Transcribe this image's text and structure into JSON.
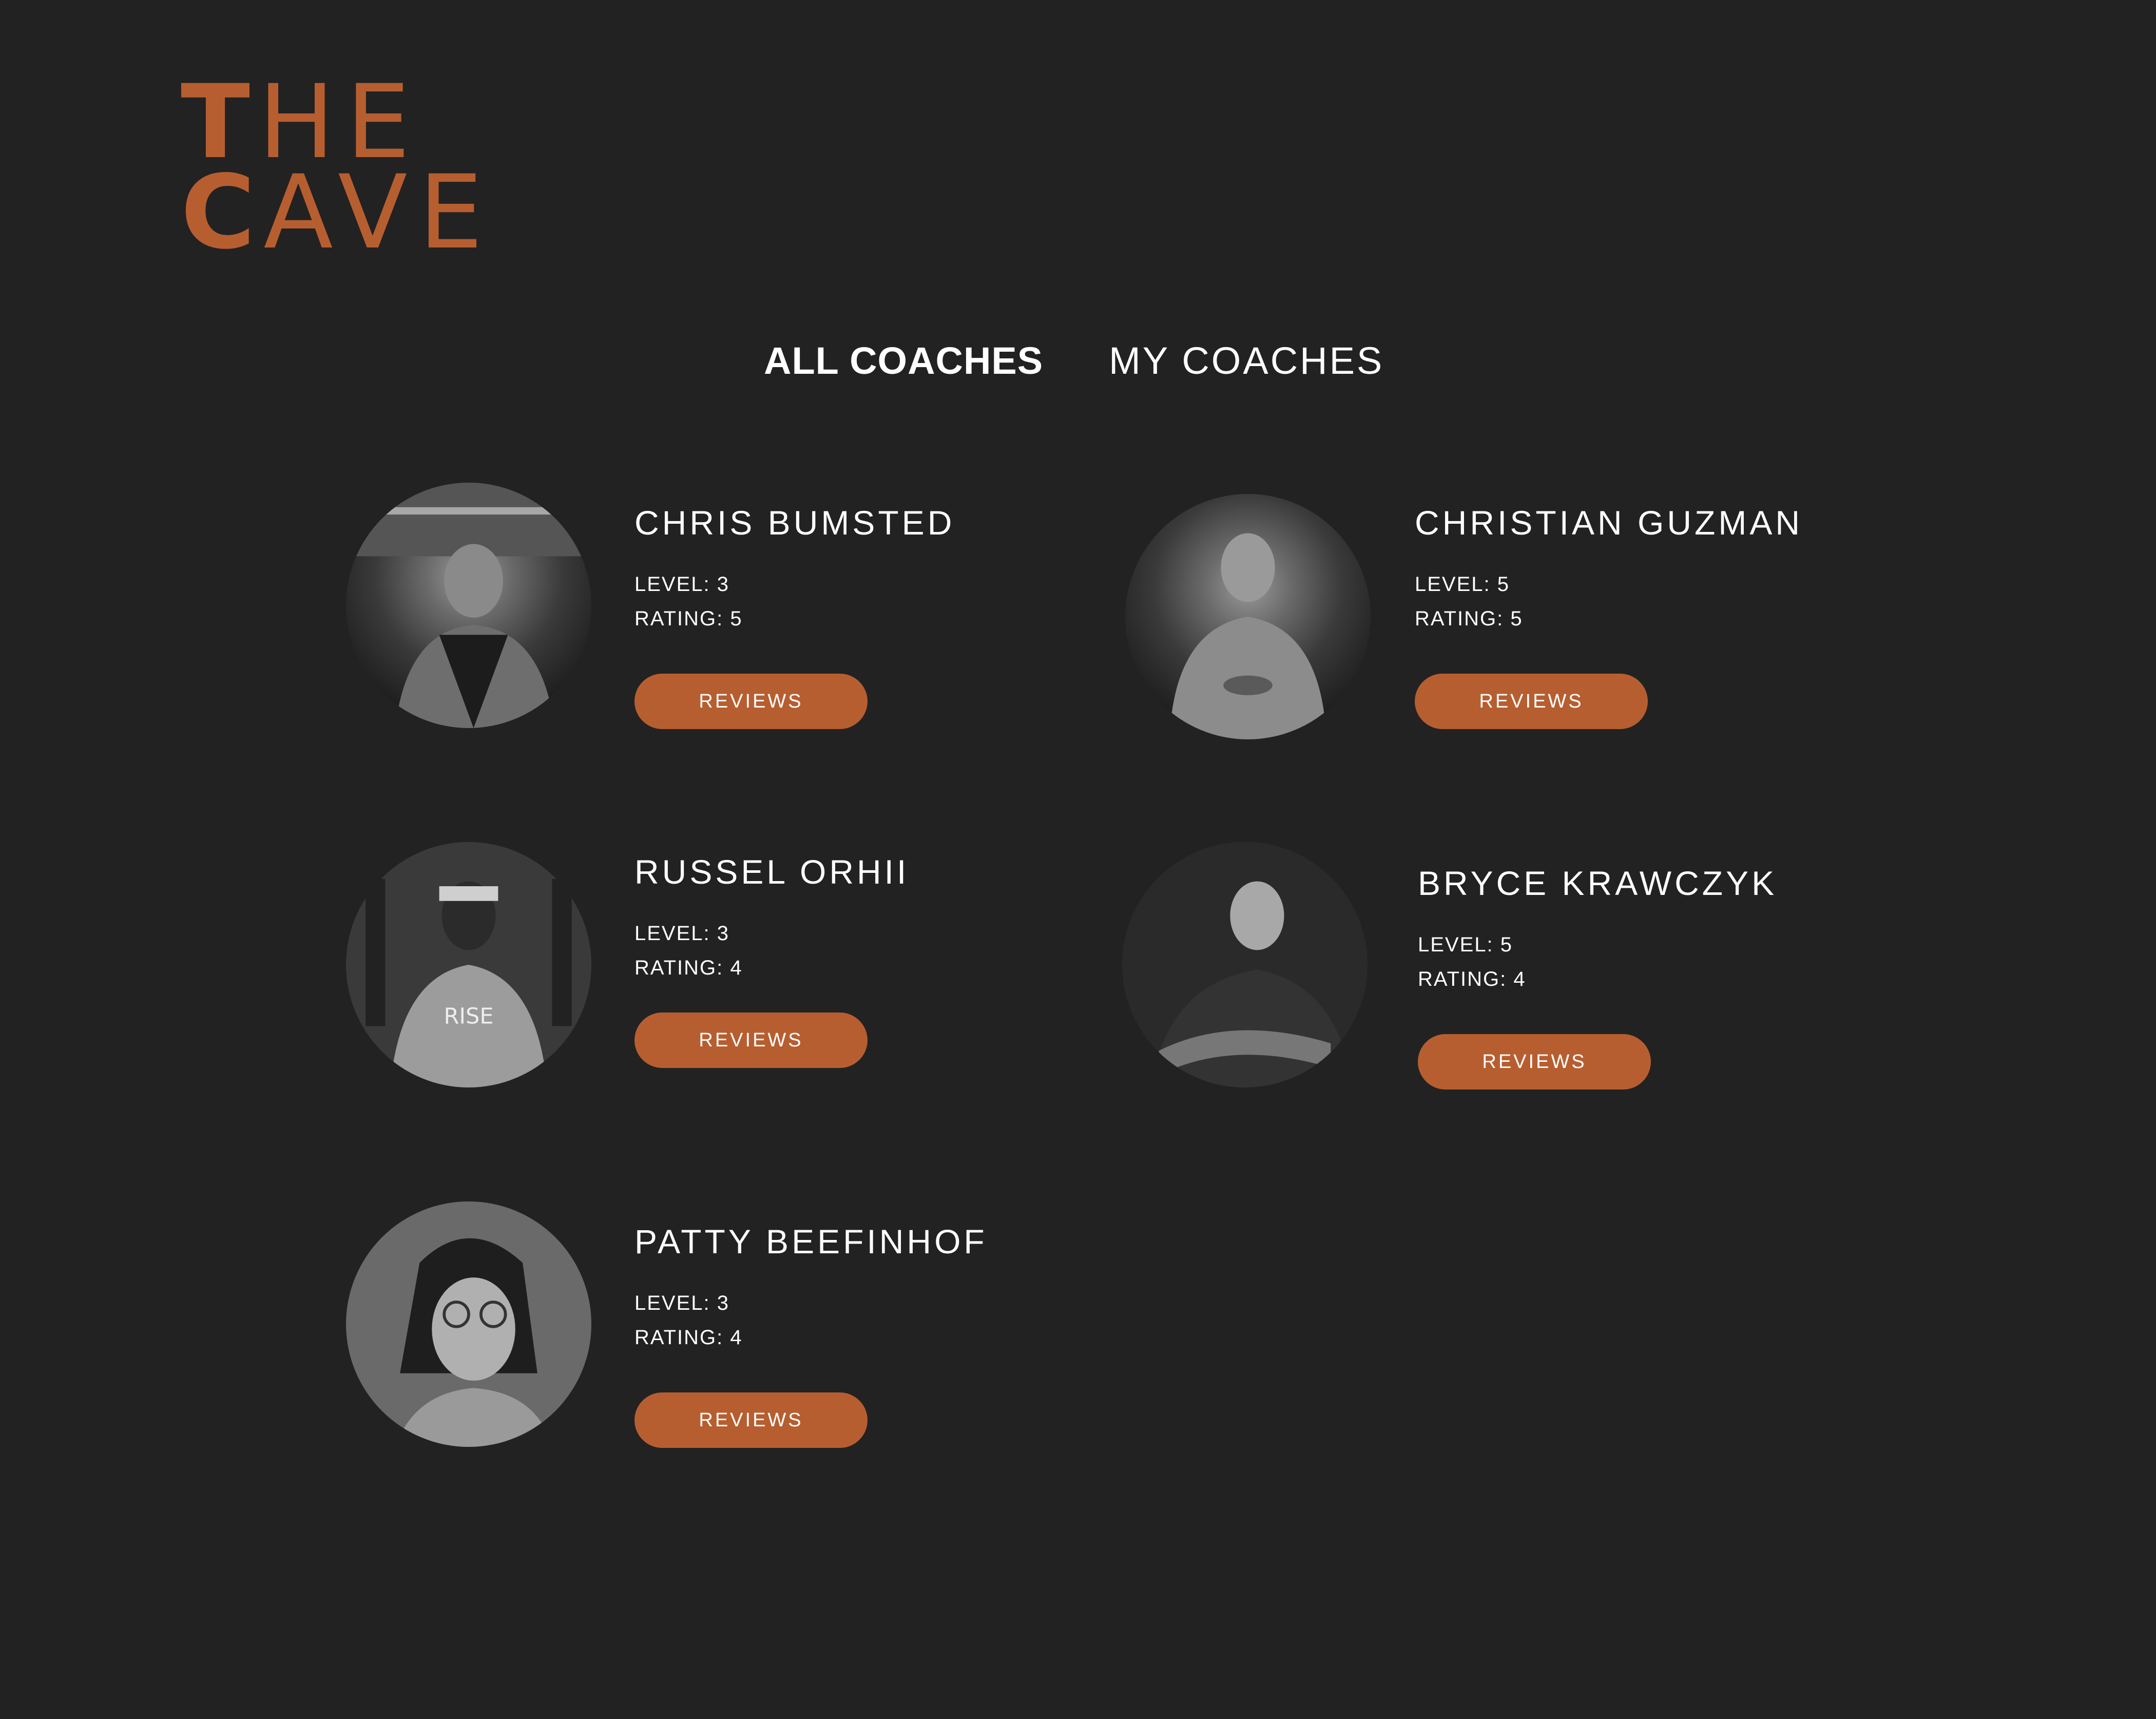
{
  "logo": {
    "line1_cap": "T",
    "line1_rest": "HE",
    "line2_cap": "C",
    "line2_rest": "AVE"
  },
  "tabs": [
    {
      "label": "ALL COACHES",
      "active": true
    },
    {
      "label": "MY COACHES",
      "active": false
    }
  ],
  "coaches": [
    {
      "name": "CHRIS BUMSTED",
      "level": "LEVEL: 3",
      "rating": "RATING: 5",
      "button": "REVIEWS"
    },
    {
      "name": "CHRISTIAN GUZMAN",
      "level": "LEVEL: 5",
      "rating": "RATING: 5",
      "button": "REVIEWS"
    },
    {
      "name": "RUSSEL ORHII",
      "level": "LEVEL: 3",
      "rating": "RATING: 4",
      "button": "REVIEWS"
    },
    {
      "name": "BRYCE KRAWCZYK",
      "level": "LEVEL: 5",
      "rating": "RATING: 4",
      "button": "REVIEWS"
    },
    {
      "name": "PATTY BEEFINHOF",
      "level": "LEVEL: 3",
      "rating": "RATING: 4",
      "button": "REVIEWS"
    }
  ],
  "colors": {
    "background": "#222222",
    "accent": "#b75e30",
    "text": "#ffffff"
  }
}
